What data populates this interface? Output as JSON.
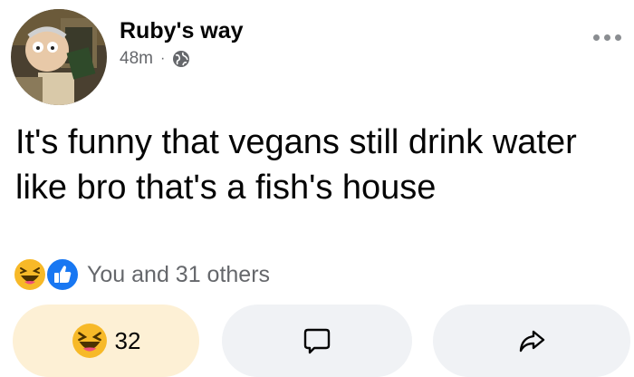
{
  "post": {
    "author": "Ruby's way",
    "time": "48m",
    "separator": "·",
    "text": "It's funny that vegans still drink water like bro that's a fish's house"
  },
  "reactions": {
    "summary": "You and 31 others",
    "icons": [
      "haha-icon",
      "like-icon"
    ]
  },
  "actions": {
    "react_count": "32",
    "react_icon": "haha-emoji-icon",
    "comment_icon": "comment-bubble-icon",
    "share_icon": "share-arrow-icon"
  },
  "colors": {
    "react_button_bg": "#fdf0d5",
    "action_button_bg": "#f0f2f5",
    "like_blue": "#1877f2",
    "haha_yellow": "#f7b928",
    "secondary_text": "#65676b"
  }
}
